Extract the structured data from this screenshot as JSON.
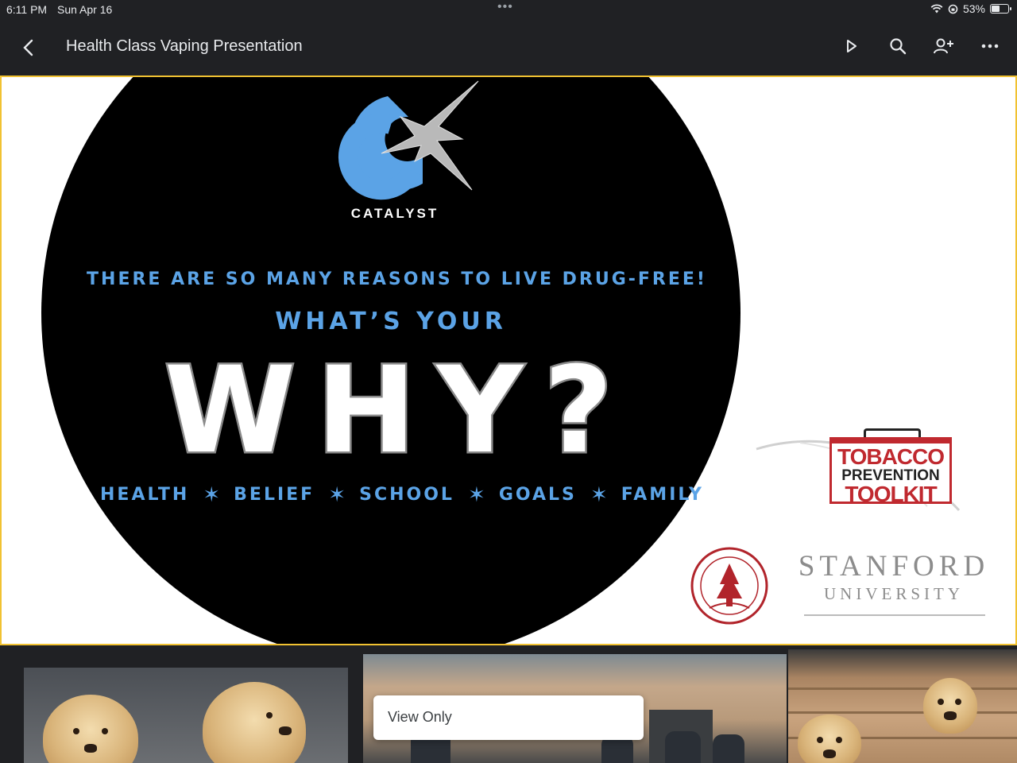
{
  "status_bar": {
    "time": "6:11 PM",
    "date": "Sun Apr 16",
    "battery": "53%",
    "battery_level": 0.53
  },
  "app_bar": {
    "title": "Health Class Vaping Presentation",
    "icons": [
      "back-icon",
      "play-icon",
      "search-icon",
      "add-person-icon",
      "more-icon"
    ]
  },
  "slide": {
    "logo_text": "CATALYST",
    "headline": "THERE ARE SO MANY REASONS TO LIVE DRUG-FREE!",
    "question_lead": "WHAT’S YOUR",
    "question_word": "WHY?",
    "reasons": [
      "HEALTH",
      "BELIEF",
      "SCHOOL",
      "GOALS",
      "FAMILY"
    ],
    "toolkit": {
      "line1": "TOBACCO",
      "line2": "PREVENTION",
      "line3": "TOOLKIT"
    },
    "university": {
      "name": "STANFORD",
      "sub": "UNIVERSITY"
    },
    "colors": {
      "accent_blue": "#5ba3e6",
      "toolkit_red": "#c0292f",
      "slide_border": "#f1c232"
    }
  },
  "toast": {
    "text": "View Only"
  }
}
